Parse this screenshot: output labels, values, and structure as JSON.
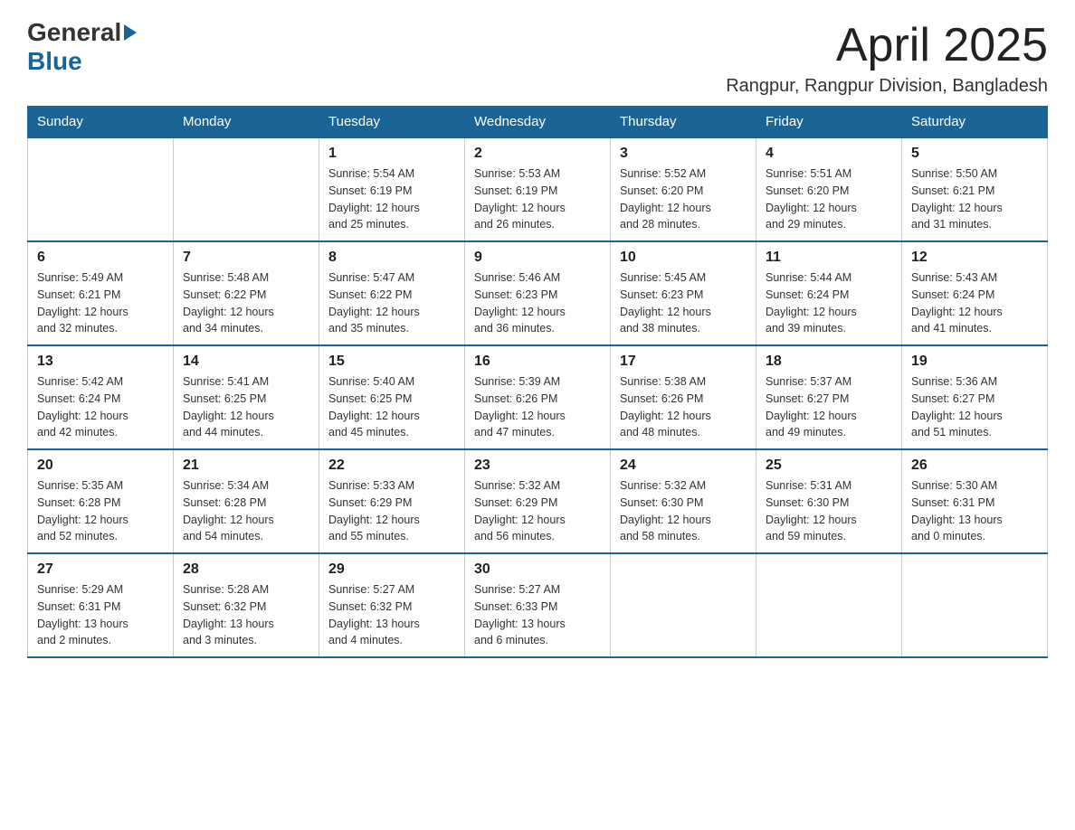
{
  "header": {
    "logo_general": "General",
    "logo_blue": "Blue",
    "title": "April 2025",
    "subtitle": "Rangpur, Rangpur Division, Bangladesh"
  },
  "days_of_week": [
    "Sunday",
    "Monday",
    "Tuesday",
    "Wednesday",
    "Thursday",
    "Friday",
    "Saturday"
  ],
  "weeks": [
    [
      {
        "day": "",
        "info": ""
      },
      {
        "day": "",
        "info": ""
      },
      {
        "day": "1",
        "info": "Sunrise: 5:54 AM\nSunset: 6:19 PM\nDaylight: 12 hours\nand 25 minutes."
      },
      {
        "day": "2",
        "info": "Sunrise: 5:53 AM\nSunset: 6:19 PM\nDaylight: 12 hours\nand 26 minutes."
      },
      {
        "day": "3",
        "info": "Sunrise: 5:52 AM\nSunset: 6:20 PM\nDaylight: 12 hours\nand 28 minutes."
      },
      {
        "day": "4",
        "info": "Sunrise: 5:51 AM\nSunset: 6:20 PM\nDaylight: 12 hours\nand 29 minutes."
      },
      {
        "day": "5",
        "info": "Sunrise: 5:50 AM\nSunset: 6:21 PM\nDaylight: 12 hours\nand 31 minutes."
      }
    ],
    [
      {
        "day": "6",
        "info": "Sunrise: 5:49 AM\nSunset: 6:21 PM\nDaylight: 12 hours\nand 32 minutes."
      },
      {
        "day": "7",
        "info": "Sunrise: 5:48 AM\nSunset: 6:22 PM\nDaylight: 12 hours\nand 34 minutes."
      },
      {
        "day": "8",
        "info": "Sunrise: 5:47 AM\nSunset: 6:22 PM\nDaylight: 12 hours\nand 35 minutes."
      },
      {
        "day": "9",
        "info": "Sunrise: 5:46 AM\nSunset: 6:23 PM\nDaylight: 12 hours\nand 36 minutes."
      },
      {
        "day": "10",
        "info": "Sunrise: 5:45 AM\nSunset: 6:23 PM\nDaylight: 12 hours\nand 38 minutes."
      },
      {
        "day": "11",
        "info": "Sunrise: 5:44 AM\nSunset: 6:24 PM\nDaylight: 12 hours\nand 39 minutes."
      },
      {
        "day": "12",
        "info": "Sunrise: 5:43 AM\nSunset: 6:24 PM\nDaylight: 12 hours\nand 41 minutes."
      }
    ],
    [
      {
        "day": "13",
        "info": "Sunrise: 5:42 AM\nSunset: 6:24 PM\nDaylight: 12 hours\nand 42 minutes."
      },
      {
        "day": "14",
        "info": "Sunrise: 5:41 AM\nSunset: 6:25 PM\nDaylight: 12 hours\nand 44 minutes."
      },
      {
        "day": "15",
        "info": "Sunrise: 5:40 AM\nSunset: 6:25 PM\nDaylight: 12 hours\nand 45 minutes."
      },
      {
        "day": "16",
        "info": "Sunrise: 5:39 AM\nSunset: 6:26 PM\nDaylight: 12 hours\nand 47 minutes."
      },
      {
        "day": "17",
        "info": "Sunrise: 5:38 AM\nSunset: 6:26 PM\nDaylight: 12 hours\nand 48 minutes."
      },
      {
        "day": "18",
        "info": "Sunrise: 5:37 AM\nSunset: 6:27 PM\nDaylight: 12 hours\nand 49 minutes."
      },
      {
        "day": "19",
        "info": "Sunrise: 5:36 AM\nSunset: 6:27 PM\nDaylight: 12 hours\nand 51 minutes."
      }
    ],
    [
      {
        "day": "20",
        "info": "Sunrise: 5:35 AM\nSunset: 6:28 PM\nDaylight: 12 hours\nand 52 minutes."
      },
      {
        "day": "21",
        "info": "Sunrise: 5:34 AM\nSunset: 6:28 PM\nDaylight: 12 hours\nand 54 minutes."
      },
      {
        "day": "22",
        "info": "Sunrise: 5:33 AM\nSunset: 6:29 PM\nDaylight: 12 hours\nand 55 minutes."
      },
      {
        "day": "23",
        "info": "Sunrise: 5:32 AM\nSunset: 6:29 PM\nDaylight: 12 hours\nand 56 minutes."
      },
      {
        "day": "24",
        "info": "Sunrise: 5:32 AM\nSunset: 6:30 PM\nDaylight: 12 hours\nand 58 minutes."
      },
      {
        "day": "25",
        "info": "Sunrise: 5:31 AM\nSunset: 6:30 PM\nDaylight: 12 hours\nand 59 minutes."
      },
      {
        "day": "26",
        "info": "Sunrise: 5:30 AM\nSunset: 6:31 PM\nDaylight: 13 hours\nand 0 minutes."
      }
    ],
    [
      {
        "day": "27",
        "info": "Sunrise: 5:29 AM\nSunset: 6:31 PM\nDaylight: 13 hours\nand 2 minutes."
      },
      {
        "day": "28",
        "info": "Sunrise: 5:28 AM\nSunset: 6:32 PM\nDaylight: 13 hours\nand 3 minutes."
      },
      {
        "day": "29",
        "info": "Sunrise: 5:27 AM\nSunset: 6:32 PM\nDaylight: 13 hours\nand 4 minutes."
      },
      {
        "day": "30",
        "info": "Sunrise: 5:27 AM\nSunset: 6:33 PM\nDaylight: 13 hours\nand 6 minutes."
      },
      {
        "day": "",
        "info": ""
      },
      {
        "day": "",
        "info": ""
      },
      {
        "day": "",
        "info": ""
      }
    ]
  ]
}
